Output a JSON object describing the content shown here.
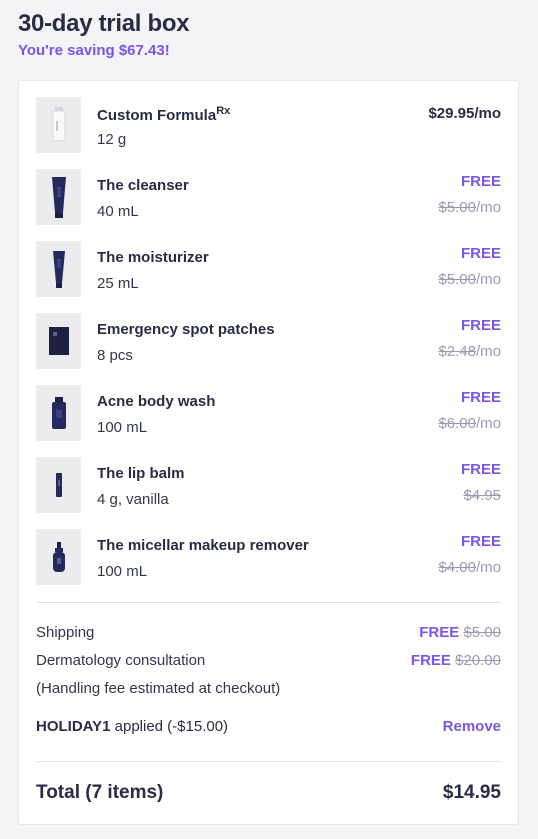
{
  "header": {
    "title": "30-day trial box",
    "saving": "You're saving $67.43!"
  },
  "items": [
    {
      "name": "Custom Formula",
      "sup": "Rx",
      "size": "12 g",
      "price": "$29.95/mo",
      "icon": "pump-bottle-icon"
    },
    {
      "name": "The cleanser",
      "size": "40 mL",
      "free": "FREE",
      "old_price": "$5.00",
      "per": "/mo",
      "icon": "tube-icon"
    },
    {
      "name": "The moisturizer",
      "size": "25 mL",
      "free": "FREE",
      "old_price": "$5.00",
      "per": "/mo",
      "icon": "tube-icon"
    },
    {
      "name": "Emergency spot patches",
      "size": "8 pcs",
      "free": "FREE",
      "old_price": "$2.48",
      "per": "/mo",
      "icon": "patch-pack-icon"
    },
    {
      "name": "Acne body wash",
      "size": "100 mL",
      "free": "FREE",
      "old_price": "$6.00",
      "per": "/mo",
      "icon": "bottle-icon"
    },
    {
      "name": "The lip balm",
      "size": "4 g, vanilla",
      "free": "FREE",
      "old_price": "$4.95",
      "per": "",
      "icon": "lip-balm-icon"
    },
    {
      "name": "The micellar makeup remover",
      "size": "100 mL",
      "free": "FREE",
      "old_price": "$4.00",
      "per": "/mo",
      "icon": "dropper-bottle-icon"
    }
  ],
  "summary": {
    "shipping_label": "Shipping",
    "shipping_free": "FREE",
    "shipping_old": "$5.00",
    "consult_label": "Dermatology consultation",
    "consult_free": "FREE",
    "consult_old": "$20.00",
    "handling_note": "(Handling fee estimated at checkout)"
  },
  "promo": {
    "code": "HOLIDAY1",
    "applied_text": "applied (-$15.00)",
    "remove_label": "Remove"
  },
  "total": {
    "label": "Total (7 items)",
    "value": "$14.95"
  },
  "colors": {
    "accent": "#7a55e8",
    "text": "#2a2b45",
    "muted": "#9a9bb0",
    "product_navy": "#242a5c"
  }
}
